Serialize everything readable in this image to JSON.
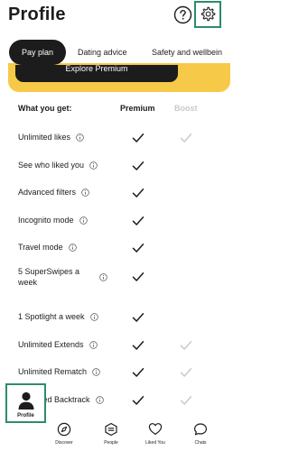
{
  "header": {
    "title": "Profile",
    "help_icon": "help-circle-icon",
    "settings_icon": "gear-icon"
  },
  "tabs": [
    {
      "label": "Pay plan",
      "active": true
    },
    {
      "label": "Dating advice",
      "active": false
    },
    {
      "label": "Safety and wellbeing",
      "active": false
    }
  ],
  "banner": {
    "button_label": "Explore Premium",
    "color": "#f7c948"
  },
  "table": {
    "col_what": "What you get:",
    "col_premium": "Premium",
    "col_boost": "Boost",
    "rows": [
      {
        "label": "Unlimited likes",
        "premium": true,
        "boost": true
      },
      {
        "label": "See who liked you",
        "premium": true,
        "boost": false
      },
      {
        "label": "Advanced filters",
        "premium": true,
        "boost": false
      },
      {
        "label": "Incognito mode",
        "premium": true,
        "boost": false
      },
      {
        "label": "Travel mode",
        "premium": true,
        "boost": false
      },
      {
        "label": "5 SuperSwipes a week",
        "premium": true,
        "boost": false
      },
      {
        "label": "1 Spotlight a week",
        "premium": true,
        "boost": false
      },
      {
        "label": "Unlimited Extends",
        "premium": true,
        "boost": true
      },
      {
        "label": "Unlimited Rematch",
        "premium": true,
        "boost": true
      },
      {
        "label": "Unlimited Backtrack",
        "premium": true,
        "boost": true
      }
    ]
  },
  "nav": [
    {
      "label": "Profile",
      "icon": "person-icon",
      "active": true
    },
    {
      "label": "Discover",
      "icon": "compass-icon",
      "active": false
    },
    {
      "label": "People",
      "icon": "people-icon",
      "active": false
    },
    {
      "label": "Liked You",
      "icon": "heart-icon",
      "active": false
    },
    {
      "label": "Chats",
      "icon": "chat-icon",
      "active": false
    }
  ],
  "colors": {
    "highlight": "#2e8b6e",
    "text": "#1c1c1c",
    "boost_muted": "#c9c9c9"
  }
}
